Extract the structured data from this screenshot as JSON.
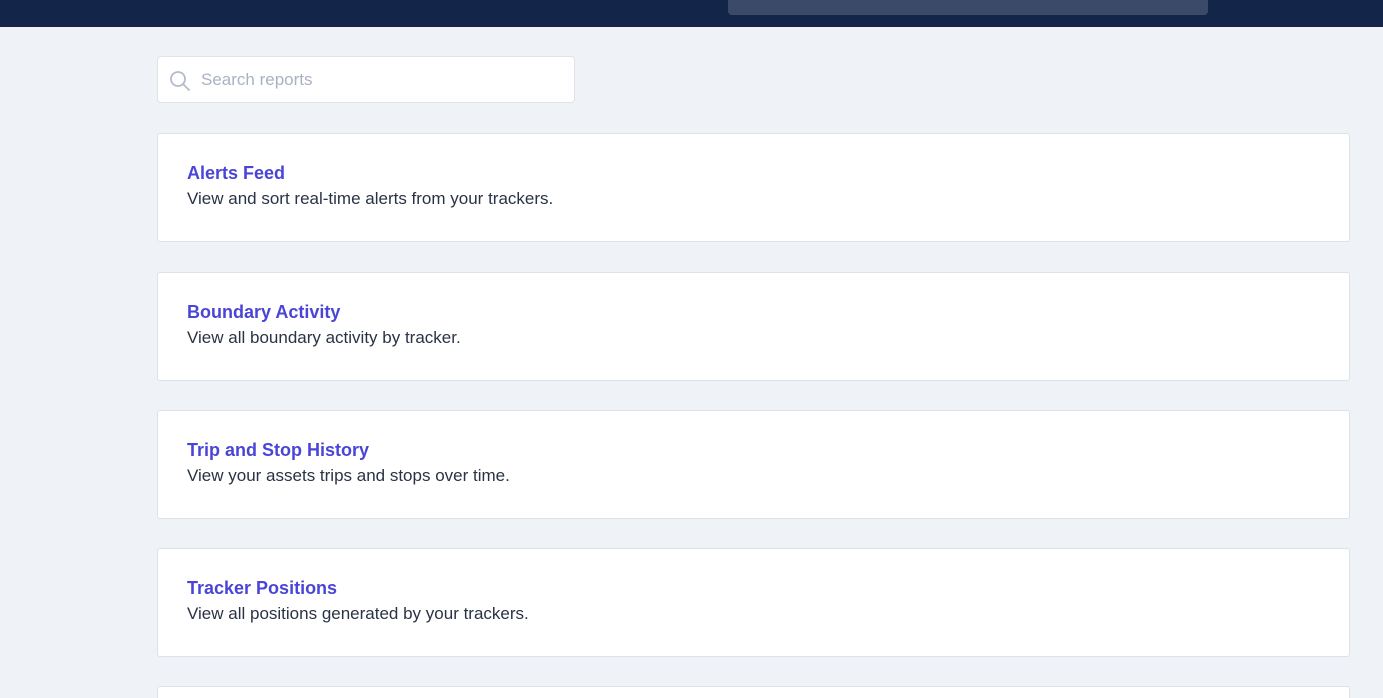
{
  "search": {
    "placeholder": "Search reports",
    "value": ""
  },
  "reports": [
    {
      "title": "Alerts Feed",
      "description": "View and sort real-time alerts from your trackers."
    },
    {
      "title": "Boundary Activity",
      "description": "View all boundary activity by tracker."
    },
    {
      "title": "Trip and Stop History",
      "description": "View your assets trips and stops over time."
    },
    {
      "title": "Tracker Positions",
      "description": "View all positions generated by your trackers."
    }
  ],
  "colors": {
    "topbar": "#13264a",
    "background": "#eff2f7",
    "accent": "#4a45d6",
    "text": "#2a3344"
  },
  "icons": {
    "search": "search-icon"
  }
}
